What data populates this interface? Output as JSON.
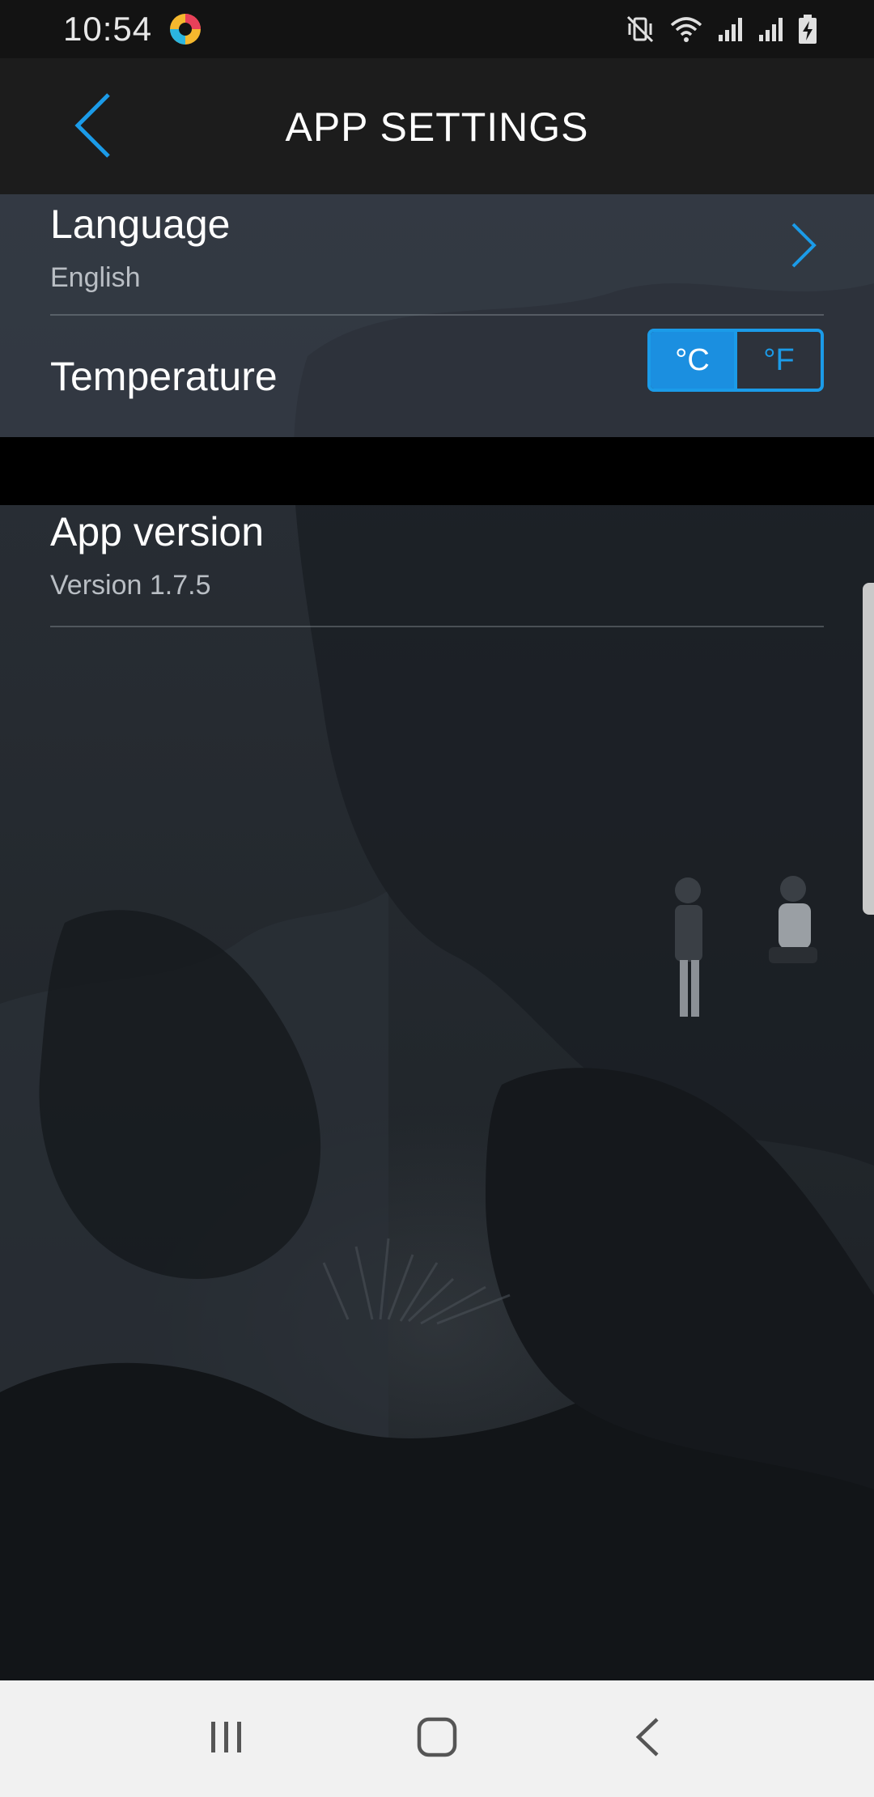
{
  "status_bar": {
    "time": "10:54",
    "icons": [
      "app-notification-icon",
      "mute-vibrate-icon",
      "wifi-icon",
      "signal-icon",
      "signal-icon",
      "battery-charging-icon"
    ]
  },
  "header": {
    "title": "APP SETTINGS",
    "back_icon": "chevron-left-icon"
  },
  "settings": {
    "language": {
      "label": "Language",
      "value": "English",
      "icon": "chevron-right-icon"
    },
    "temperature": {
      "label": "Temperature",
      "options": [
        "°C",
        "°F"
      ],
      "selected": "°C"
    },
    "app_version": {
      "label": "App version",
      "value": "Version 1.7.5"
    }
  },
  "nav_bar": {
    "buttons": [
      "recent-apps-icon",
      "home-icon",
      "back-icon"
    ]
  },
  "colors": {
    "accent": "#1b9be8",
    "header_bg": "#1c1c1c",
    "status_bar_bg": "#131313",
    "nav_bar_bg": "#f1f1f1"
  }
}
